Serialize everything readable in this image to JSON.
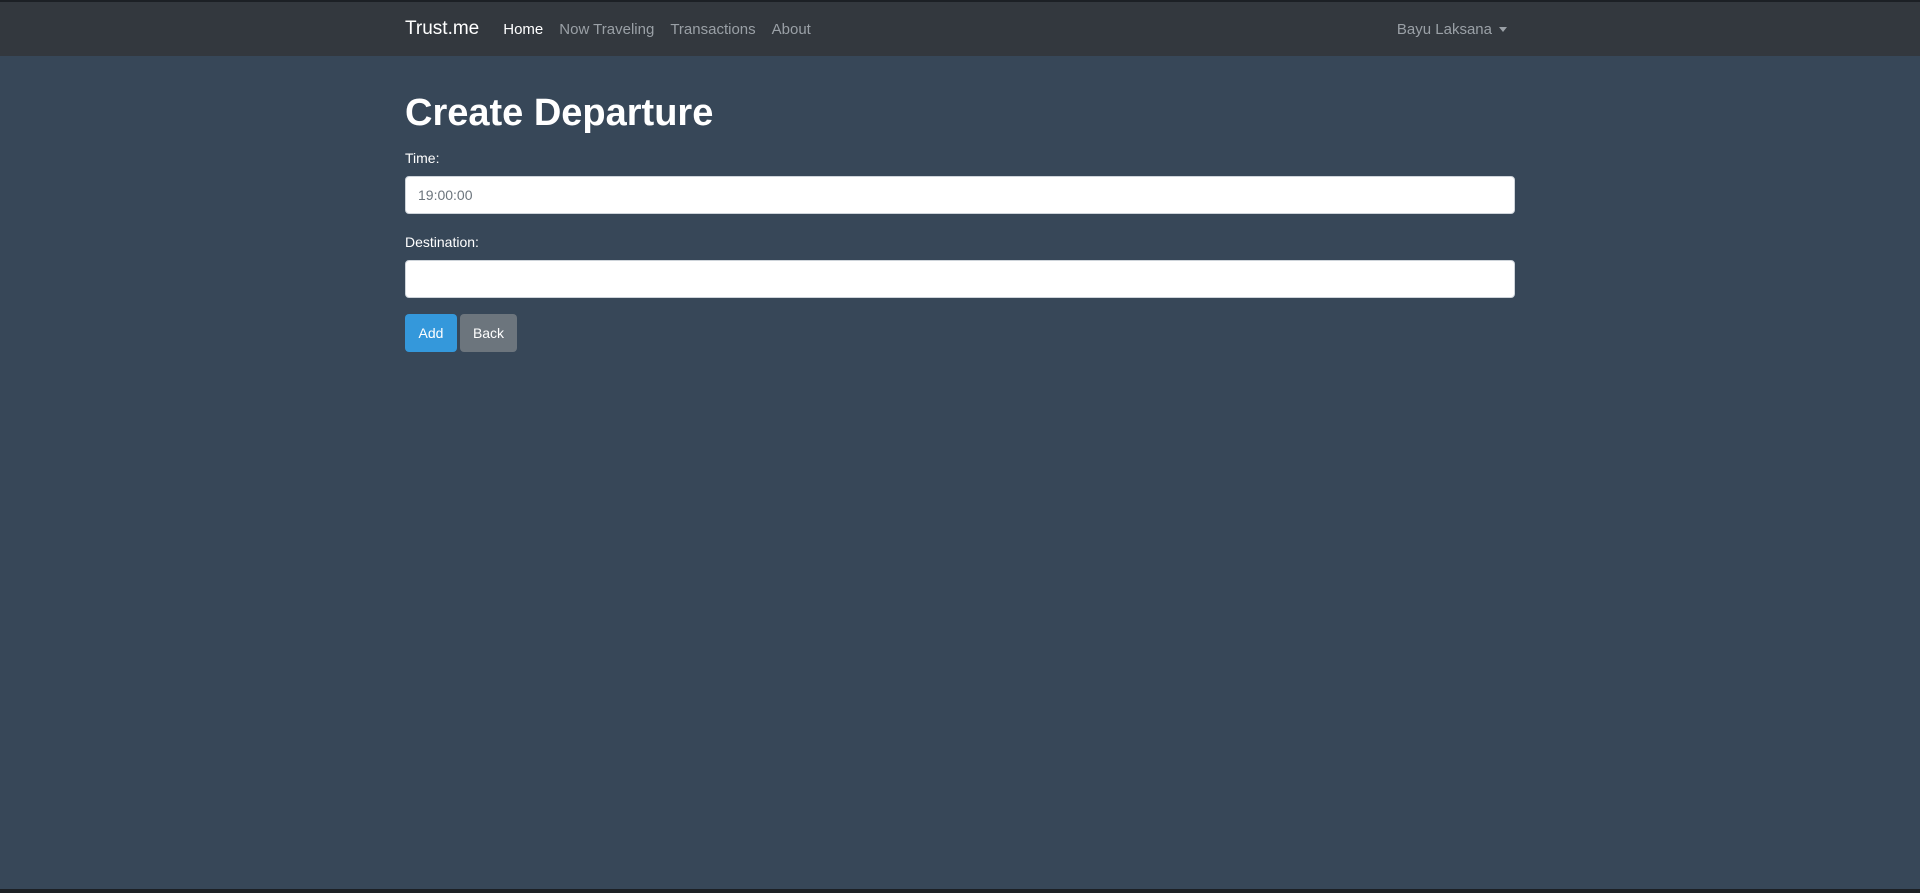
{
  "navbar": {
    "brand": "Trust.me",
    "links": [
      "Home",
      "Now Traveling",
      "Transactions",
      "About"
    ],
    "active_link": "Home",
    "user_menu_label": "Bayu Laksana"
  },
  "page": {
    "title": "Create Departure"
  },
  "form": {
    "time": {
      "label": "Time:",
      "placeholder": "19:00:00",
      "value": ""
    },
    "destination": {
      "label": "Destination:",
      "placeholder": "",
      "value": ""
    },
    "add_label": "Add",
    "back_label": "Back"
  },
  "colors": {
    "background": "#374758",
    "navbar": "#33383e",
    "primary": "#3498db",
    "secondary": "#6c757d"
  }
}
